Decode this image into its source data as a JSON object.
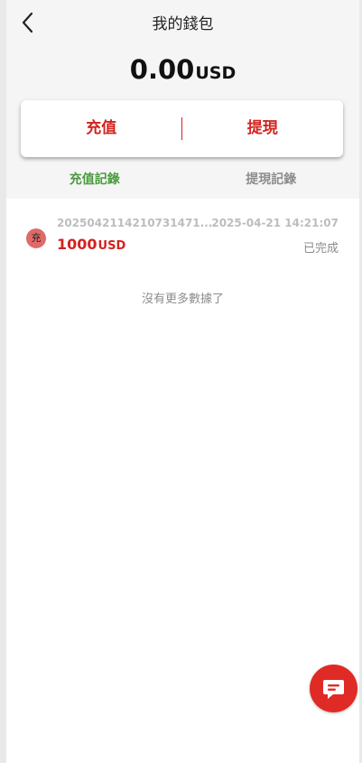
{
  "header": {
    "title": "我的錢包"
  },
  "balance": {
    "amount": "0.00",
    "currency": "USD"
  },
  "actions": {
    "deposit_label": "充值",
    "withdraw_label": "提現"
  },
  "tabs": [
    {
      "label": "充值記錄",
      "active": true
    },
    {
      "label": "提現記錄",
      "active": false
    }
  ],
  "records": [
    {
      "badge": "充",
      "order_id": "2025042114210731471...",
      "time": "2025-04-21 14:21:07",
      "amount": "1000",
      "currency": "USD",
      "status": "已完成"
    }
  ],
  "list_end_text": "沒有更多數據了",
  "colors": {
    "accent": "#d1231f",
    "tab_active": "#4a9a3e",
    "badge": "#e06a69",
    "chat": "#e02a26"
  },
  "icons": {
    "back": "chevron-left-icon",
    "chat": "chat-bubble-icon"
  }
}
